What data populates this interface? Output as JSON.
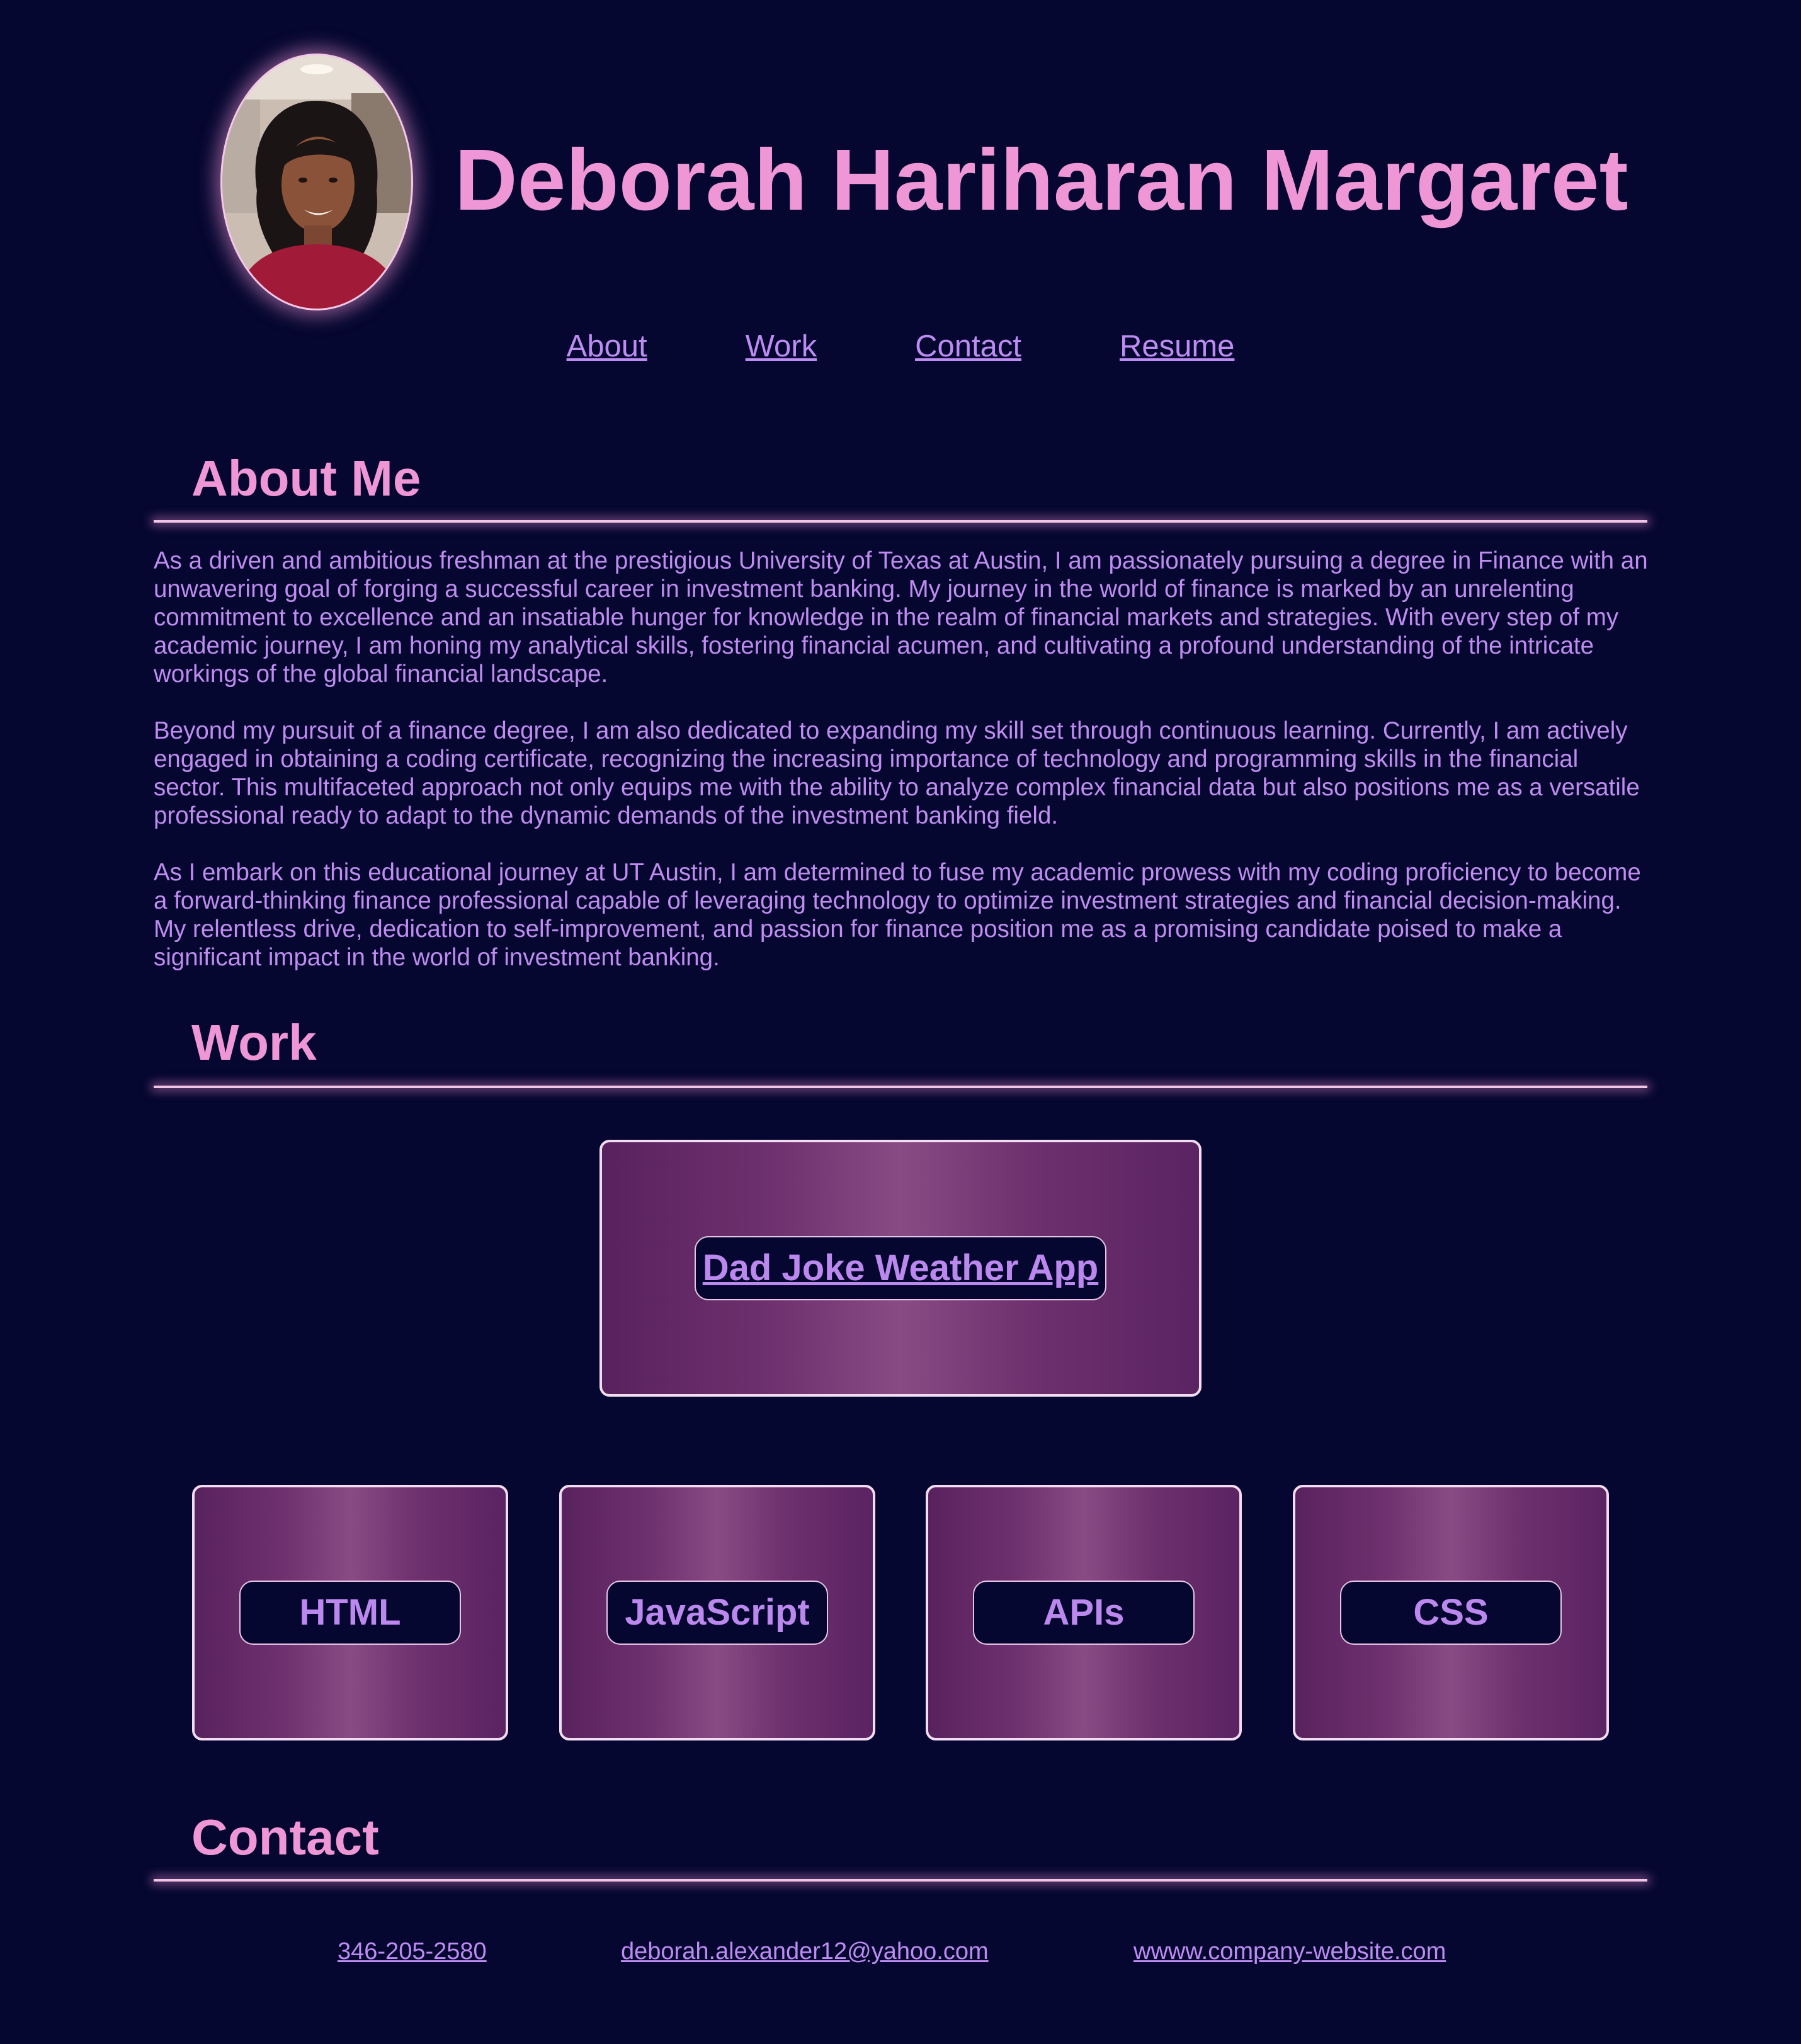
{
  "header": {
    "name": "Deborah Hariharan Margaret"
  },
  "nav": {
    "items": [
      "About",
      "Work",
      "Contact",
      "Resume"
    ]
  },
  "about": {
    "title": "About Me",
    "paragraphs": [
      "As a driven and ambitious freshman at the prestigious University of Texas at Austin, I am passionately pursuing a degree in Finance with an unwavering goal of forging a successful career in investment banking. My journey in the world of finance is marked by an unrelenting commitment to excellence and an insatiable hunger for knowledge in the realm of financial markets and strategies. With every step of my academic journey, I am honing my analytical skills, fostering financial acumen, and cultivating a profound understanding of the intricate workings of the global financial landscape.",
      "Beyond my pursuit of a finance degree, I am also dedicated to expanding my skill set through continuous learning. Currently, I am actively engaged in obtaining a coding certificate, recognizing the increasing importance of technology and programming skills in the financial sector. This multifaceted approach not only equips me with the ability to analyze complex financial data but also positions me as a versatile professional ready to adapt to the dynamic demands of the investment banking field.",
      "As I embark on this educational journey at UT Austin, I am determined to fuse my academic prowess with my coding proficiency to become a forward-thinking finance professional capable of leveraging technology to optimize investment strategies and financial decision-making. My relentless drive, dedication to self-improvement, and passion for finance position me as a promising candidate poised to make a significant impact in the world of investment banking."
    ]
  },
  "work": {
    "title": "Work",
    "project": "Dad Joke Weather App",
    "skills": [
      "HTML",
      "JavaScript",
      "APIs",
      "CSS"
    ]
  },
  "contact": {
    "title": "Contact",
    "phone": "346-205-2580",
    "email": "deborah.alexander12@yahoo.com",
    "website": "wwww.company-website.com"
  },
  "colors": {
    "background": "#050730",
    "heading": "#ef97d6",
    "text": "#bf8cf0",
    "card_gradient_mid": "#894b84"
  }
}
